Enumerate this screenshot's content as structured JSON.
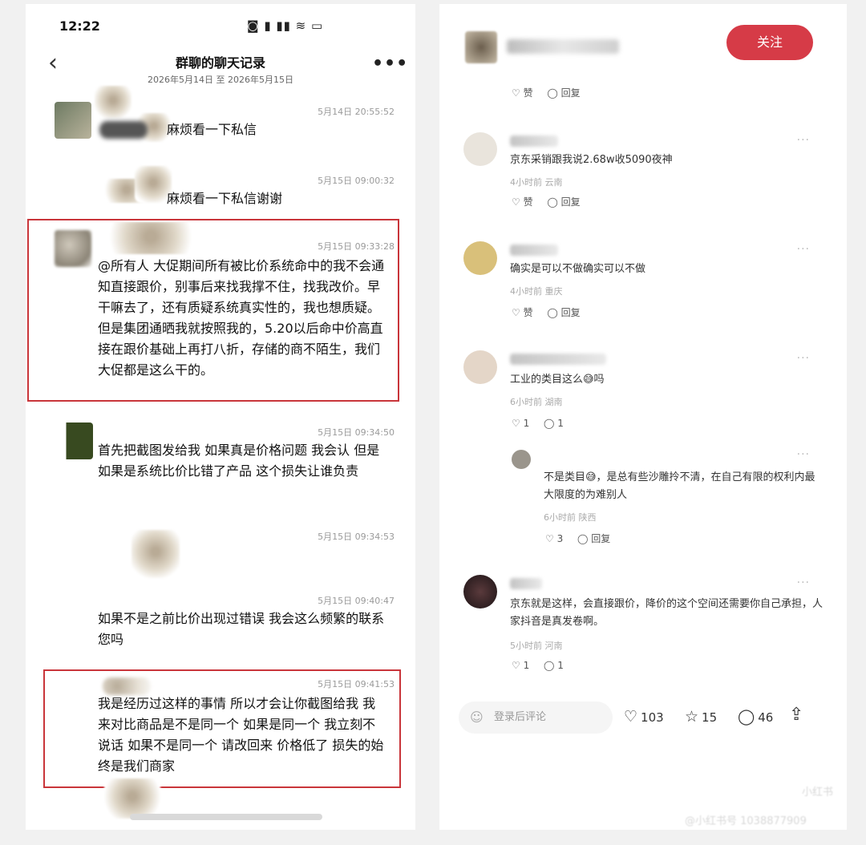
{
  "left_panel": {
    "status_bar": {
      "time": "12:22",
      "icons": "◙ ▮ ▮▮ ≋ ▭"
    },
    "nav": {
      "back_icon": "‹",
      "title": "群聊的聊天记录",
      "subtitle": "2026年5月14日 至 2026年5月15日",
      "more_icon": "•••"
    },
    "messages": [
      {
        "time": "5月14日 20:55:52",
        "text": "麻烦看一下私信"
      },
      {
        "time": "5月15日 09:00:32",
        "text": "麻烦看一下私信谢谢"
      },
      {
        "time": "5月15日 09:33:28",
        "text": "@所有人 大促期间所有被比价系统命中的我不会通知直接跟价，别事后来找我撑不住，找我改价。早干嘛去了，还有质疑系统真实性的，我也想质疑。但是集团通晒我就按照我的，5.20以后命中价高直接在跟价基础上再打八折，存储的商不陌生，我们大促都是这么干的。"
      },
      {
        "time": "5月15日 09:34:50",
        "text": "首先把截图发给我 如果真是价格问题 我会认 但是如果是系统比价比错了产品 这个损失让谁负责"
      },
      {
        "time": "5月15日 09:34:53",
        "text": ""
      },
      {
        "time": "5月15日 09:40:47",
        "text": "如果不是之前比价出现过错误 我会这么频繁的联系您吗"
      },
      {
        "time": "5月15日 09:41:53",
        "text": "我是经历过这样的事情 所以才会让你截图给我 我来对比商品是不是同一个 如果是同一个 我立刻不说话 如果不是同一个 请改回来 价格低了 损失的始终是我们商家"
      }
    ]
  },
  "right_panel": {
    "follow_label": "关注",
    "like_label": "赞",
    "reply_label": "回复",
    "comments": [
      {
        "text": "京东采销跟我说2.68w收5090夜神",
        "meta": "4小时前 云南",
        "avatar_color": "#e9e4dc"
      },
      {
        "text": "确实是可以不做确实可以不做",
        "meta": "4小时前 重庆",
        "avatar_color": "#d9c07a"
      },
      {
        "text": "工业的类目这么😅吗",
        "meta": "6小时前 湖南",
        "avatar_color": "#e4d6c8",
        "likes": "1",
        "replies": "1"
      },
      {
        "text": "不是类目😅，是总有些沙雕拎不清，在自己有限的权利内最大限度的为难别人",
        "meta": "6小时前 陕西",
        "avatar_color": "#9a958c",
        "likes": "3"
      },
      {
        "text": "京东就是这样，会直接跟价，降价的这个空间还需要你自己承担，人家抖音是真发卷啊。",
        "meta": "5小时前 河南",
        "avatar_color": "#3b2a2c",
        "likes": "1",
        "replies": "1"
      }
    ],
    "bottom_bar": {
      "input_placeholder": "登录后评论",
      "likes": "103",
      "stars": "15",
      "comments": "46"
    },
    "watermark_main": "小红书",
    "watermark_sub": "@小红书号 1038877909"
  },
  "colors": {
    "accent_red": "#d63b47",
    "highlight_box": "#c9353a"
  }
}
